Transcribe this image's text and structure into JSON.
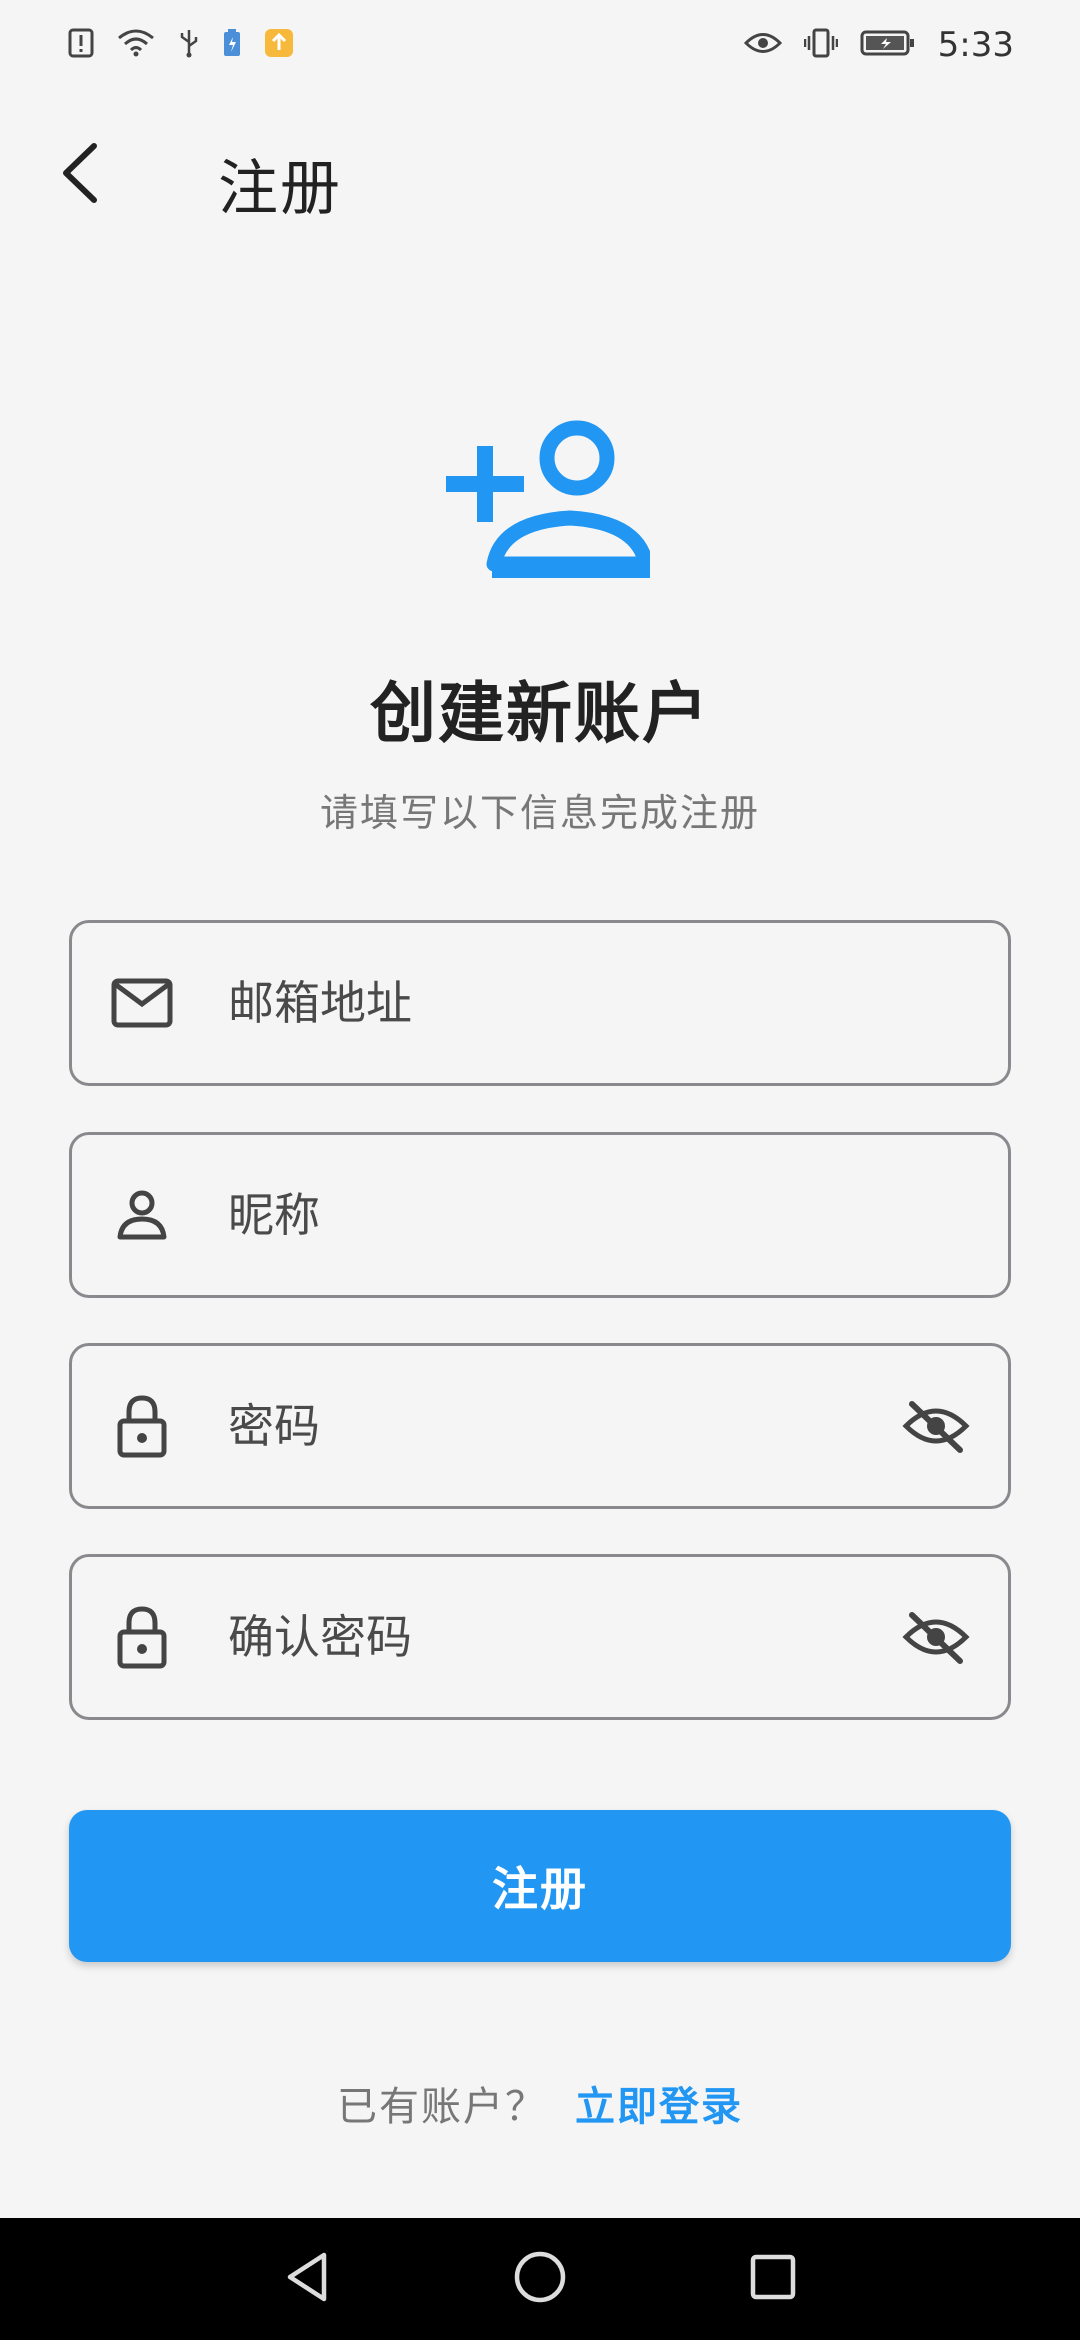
{
  "status_bar": {
    "time": "5:33",
    "left_icons": [
      "alert-icon",
      "wifi-icon",
      "usb-icon",
      "battery-saver-icon",
      "notification-app-icon"
    ],
    "right_icons": [
      "eye-comfort-icon",
      "vibrate-icon",
      "battery-icon"
    ]
  },
  "app_bar": {
    "title": "注册",
    "back_icon": "chevron-left-icon"
  },
  "header": {
    "icon": "person-add-icon",
    "title": "创建新账户",
    "subtitle": "请填写以下信息完成注册"
  },
  "form": {
    "email": {
      "placeholder": "邮箱地址",
      "value": "",
      "icon": "mail-icon"
    },
    "nickname": {
      "placeholder": "昵称",
      "value": "",
      "icon": "person-icon"
    },
    "password": {
      "placeholder": "密码",
      "value": "",
      "icon": "lock-icon",
      "toggle_icon": "visibility-off-icon"
    },
    "confirm_password": {
      "placeholder": "确认密码",
      "value": "",
      "icon": "lock-icon",
      "toggle_icon": "visibility-off-icon"
    }
  },
  "submit": {
    "label": "注册"
  },
  "footer": {
    "prompt": "已有账户？",
    "link": "立即登录"
  },
  "nav_bar": {
    "buttons": [
      "back-triangle-icon",
      "home-circle-icon",
      "recents-square-icon"
    ]
  },
  "colors": {
    "accent": "#2196f3",
    "background": "#f5f5f5",
    "border": "#8a8a8e",
    "text_primary": "#222222",
    "text_secondary": "#777777"
  }
}
